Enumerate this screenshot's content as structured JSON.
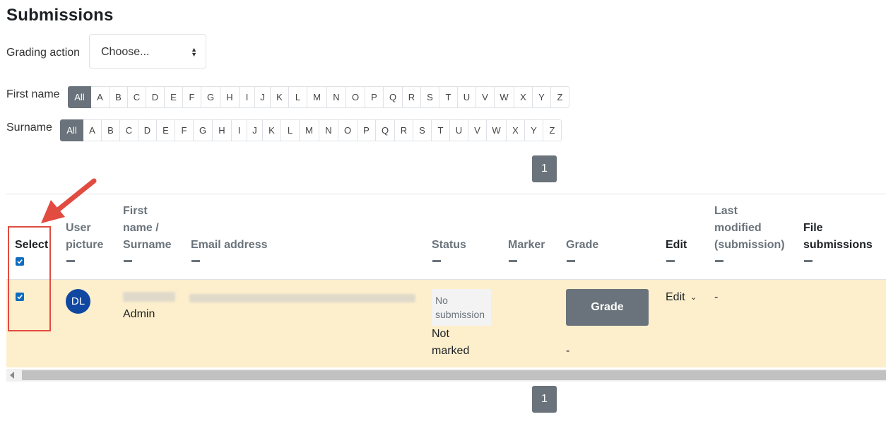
{
  "page": {
    "title": "Submissions"
  },
  "grading_action": {
    "label": "Grading action",
    "selected": "Choose..."
  },
  "first_name_filter": {
    "label": "First name",
    "all": "All",
    "letters": [
      "A",
      "B",
      "C",
      "D",
      "E",
      "F",
      "G",
      "H",
      "I",
      "J",
      "K",
      "L",
      "M",
      "N",
      "O",
      "P",
      "Q",
      "R",
      "S",
      "T",
      "U",
      "V",
      "W",
      "X",
      "Y",
      "Z"
    ]
  },
  "surname_filter": {
    "label": "Surname",
    "all": "All",
    "letters": [
      "A",
      "B",
      "C",
      "D",
      "E",
      "F",
      "G",
      "H",
      "I",
      "J",
      "K",
      "L",
      "M",
      "N",
      "O",
      "P",
      "Q",
      "R",
      "S",
      "T",
      "U",
      "V",
      "W",
      "X",
      "Y",
      "Z"
    ]
  },
  "pagination": {
    "page": "1"
  },
  "table": {
    "headers": {
      "select": "Select",
      "user_picture_1": "User",
      "user_picture_2": "picture",
      "name_1": "First",
      "name_2": "name /",
      "name_3": "Surname",
      "email": "Email address",
      "status": "Status",
      "marker": "Marker",
      "grade": "Grade",
      "edit": "Edit",
      "modified_1": "Last",
      "modified_2": "modified",
      "modified_3": "(submission)",
      "files_1": "File",
      "files_2": "submissions"
    },
    "row": {
      "avatar_initials": "DL",
      "name_line2": "Admin",
      "status_badge_1": "No",
      "status_badge_2": "submission",
      "status_line1": "Not",
      "status_line2": "marked",
      "grade_button": "Grade",
      "grade_value": "-",
      "edit_menu": "Edit",
      "last_modified": "-"
    }
  },
  "colors": {
    "row_highlight": "#fdefcc",
    "button_gray": "#6a737b",
    "annotation_red": "#e24b40",
    "avatar_blue": "#0f47a1"
  }
}
